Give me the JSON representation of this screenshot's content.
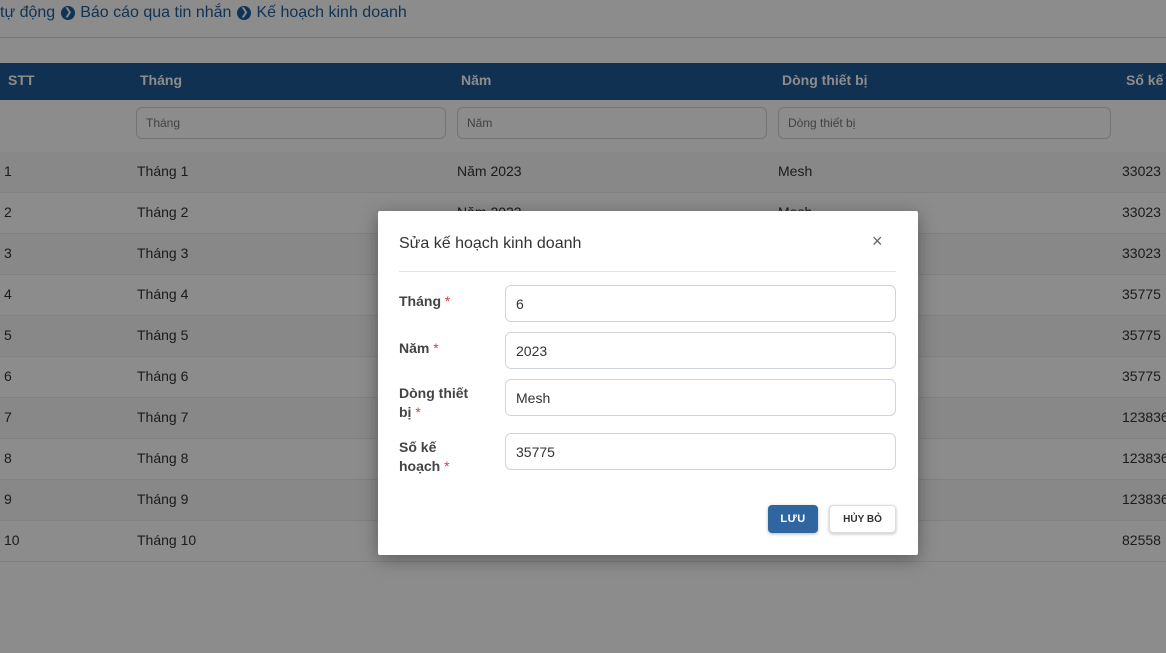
{
  "breadcrumb": {
    "item1": "tự động",
    "item2": "Báo cáo qua tin nhắn",
    "item3": "Kế hoạch kinh doanh",
    "separator": "❯"
  },
  "table": {
    "headers": [
      "STT",
      "Tháng",
      "Năm",
      "Dòng thiết bị",
      "Số kế h"
    ],
    "filters": {
      "month": "Tháng",
      "year": "Năm",
      "device": "Dòng thiết bị"
    },
    "rows": [
      {
        "stt": "1",
        "month": "Tháng 1",
        "year": "Năm 2023",
        "device": "Mesh",
        "plan": "33023"
      },
      {
        "stt": "2",
        "month": "Tháng 2",
        "year": "Năm 2023",
        "device": "Mesh",
        "plan": "33023"
      },
      {
        "stt": "3",
        "month": "Tháng 3",
        "year": "",
        "device": "",
        "plan": "33023"
      },
      {
        "stt": "4",
        "month": "Tháng 4",
        "year": "",
        "device": "",
        "plan": "35775"
      },
      {
        "stt": "5",
        "month": "Tháng 5",
        "year": "",
        "device": "",
        "plan": "35775"
      },
      {
        "stt": "6",
        "month": "Tháng 6",
        "year": "",
        "device": "",
        "plan": "35775"
      },
      {
        "stt": "7",
        "month": "Tháng 7",
        "year": "",
        "device": "",
        "plan": "123836"
      },
      {
        "stt": "8",
        "month": "Tháng 8",
        "year": "",
        "device": "",
        "plan": "123836"
      },
      {
        "stt": "9",
        "month": "Tháng 9",
        "year": "",
        "device": "",
        "plan": "123836"
      },
      {
        "stt": "10",
        "month": "Tháng 10",
        "year": "",
        "device": "",
        "plan": "82558"
      }
    ]
  },
  "modal": {
    "title": "Sửa kế hoạch kinh doanh",
    "close_icon": "×",
    "fields": {
      "month": {
        "label_line1": "Tháng",
        "label_line2": "",
        "value": "6"
      },
      "year": {
        "label_line1": "Năm",
        "label_line2": "",
        "value": "2023"
      },
      "device": {
        "label_line1": "Dòng thiết",
        "label_line2": "bị",
        "value": "Mesh"
      },
      "plan": {
        "label_line1": "Số kế",
        "label_line2": "hoạch",
        "value": "35775"
      }
    },
    "required_mark": "*",
    "save_label": "LƯU",
    "cancel_label": "HỦY BỎ"
  },
  "colors": {
    "header_bg": "#1e5a94",
    "save_btn": "#2f66a0",
    "required": "#e0394a"
  }
}
